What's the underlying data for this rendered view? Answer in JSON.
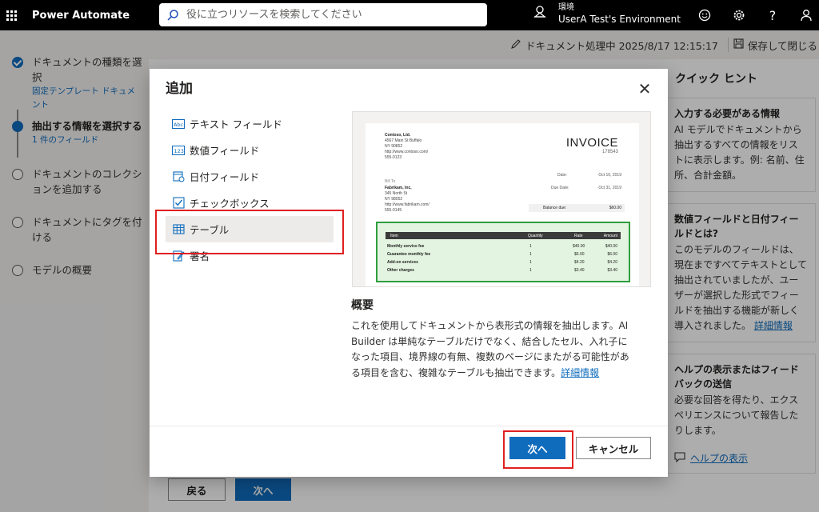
{
  "app": {
    "title": "Power Automate",
    "search_placeholder": "役に立つリソースを検索してください",
    "environment_label": "環境",
    "environment_name": "UserA Test's Environment"
  },
  "topbar_icons": [
    "waffle-icon",
    "environment-icon",
    "smiley-icon",
    "gear-icon",
    "help-icon",
    "user-icon"
  ],
  "command_bar": {
    "status": "ドキュメント処理中 2025/8/17 12:15:17",
    "save_close": "保存して閉じる"
  },
  "steps": [
    {
      "title": "ドキュメントの種類を選択",
      "sub": "固定テンプレート ドキュメント",
      "state": "done"
    },
    {
      "title": "抽出する情報を選択する",
      "sub": "1 件のフィールド",
      "state": "current"
    },
    {
      "title": "ドキュメントのコレクションを追加する",
      "sub": "",
      "state": "todo"
    },
    {
      "title": "ドキュメントにタグを付ける",
      "sub": "",
      "state": "todo"
    },
    {
      "title": "モデルの概要",
      "sub": "",
      "state": "todo"
    }
  ],
  "page_buttons": {
    "back": "戻る",
    "next": "次へ"
  },
  "hints": {
    "title": "クイック ヒント",
    "cards": [
      {
        "heading": "入力する必要がある情報",
        "body": "AI モデルでドキュメントから抽出するすべての情報をリストに表示します。例: 名前、住所、合計金額。",
        "link": ""
      },
      {
        "heading": "数値フィールドと日付フィールドとは?",
        "body": "このモデルのフィールドは、現在まですべてテキストとして抽出されていましたが、ユーザーが選択した形式でフィールドを抽出する機能が新しく導入されました。",
        "link": "詳細情報"
      },
      {
        "heading": "ヘルプの表示またはフィードバックの送信",
        "body": "必要な回答を得たり、エクスペリエンスについて報告したりします。",
        "link": ""
      }
    ],
    "help_link": "ヘルプの表示"
  },
  "modal": {
    "title": "追加",
    "fields": [
      {
        "label": "テキスト フィールド",
        "icon": "text-field-icon",
        "selected": false
      },
      {
        "label": "数値フィールド",
        "icon": "number-field-icon",
        "selected": false
      },
      {
        "label": "日付フィールド",
        "icon": "date-field-icon",
        "selected": false
      },
      {
        "label": "チェックボックス",
        "icon": "checkbox-icon",
        "selected": false
      },
      {
        "label": "テーブル",
        "icon": "table-icon",
        "selected": true
      },
      {
        "label": "署名",
        "icon": "signature-icon",
        "selected": false
      }
    ],
    "preview_invoice": {
      "company": [
        "Contoso, Ltd.",
        "4567 Main St Buffalo",
        "NY 90852",
        "http://www.contoso.com/",
        "555-0123"
      ],
      "title": "INVOICE",
      "number": "178543",
      "bill_to_label": "Bill To",
      "bill_to": [
        "Fabrikam, Inc.",
        "345 North St",
        "NY 98052",
        "http://www.fabrikam.com/",
        "555-0145"
      ],
      "date_label": "Date:",
      "date": "Oct 10, 2019",
      "due_label": "Due Date:",
      "due": "Oct 31, 2019",
      "balance_label": "Balance due:",
      "balance": "$60.00",
      "table_headers": [
        "Item",
        "Quantity",
        "Rate",
        "Amount"
      ],
      "table_rows": [
        [
          "Monthly service fee",
          "1",
          "$40.00",
          "$40.00"
        ],
        [
          "Guarantee monthly fee",
          "1",
          "$6.00",
          "$6.00"
        ],
        [
          "Add-on services",
          "1",
          "$4.20",
          "$4.20"
        ],
        [
          "Other charges",
          "1",
          "$3.40",
          "$3.40"
        ]
      ]
    },
    "overview_title": "概要",
    "overview_text": "これを使用してドキュメントから表形式の情報を抽出します。AI Builder は単純なテーブルだけでなく、結合したセル、入れ子になった項目、境界線の有無、複数のページにまたがる可能性がある項目を含む、複雑なテーブルも抽出できます。",
    "overview_link": "詳細情報",
    "next": "次へ",
    "cancel": "キャンセル"
  },
  "colors": {
    "brand": "#0f6cbd",
    "highlight": "#e02020",
    "table_green": "#2e9e40"
  }
}
